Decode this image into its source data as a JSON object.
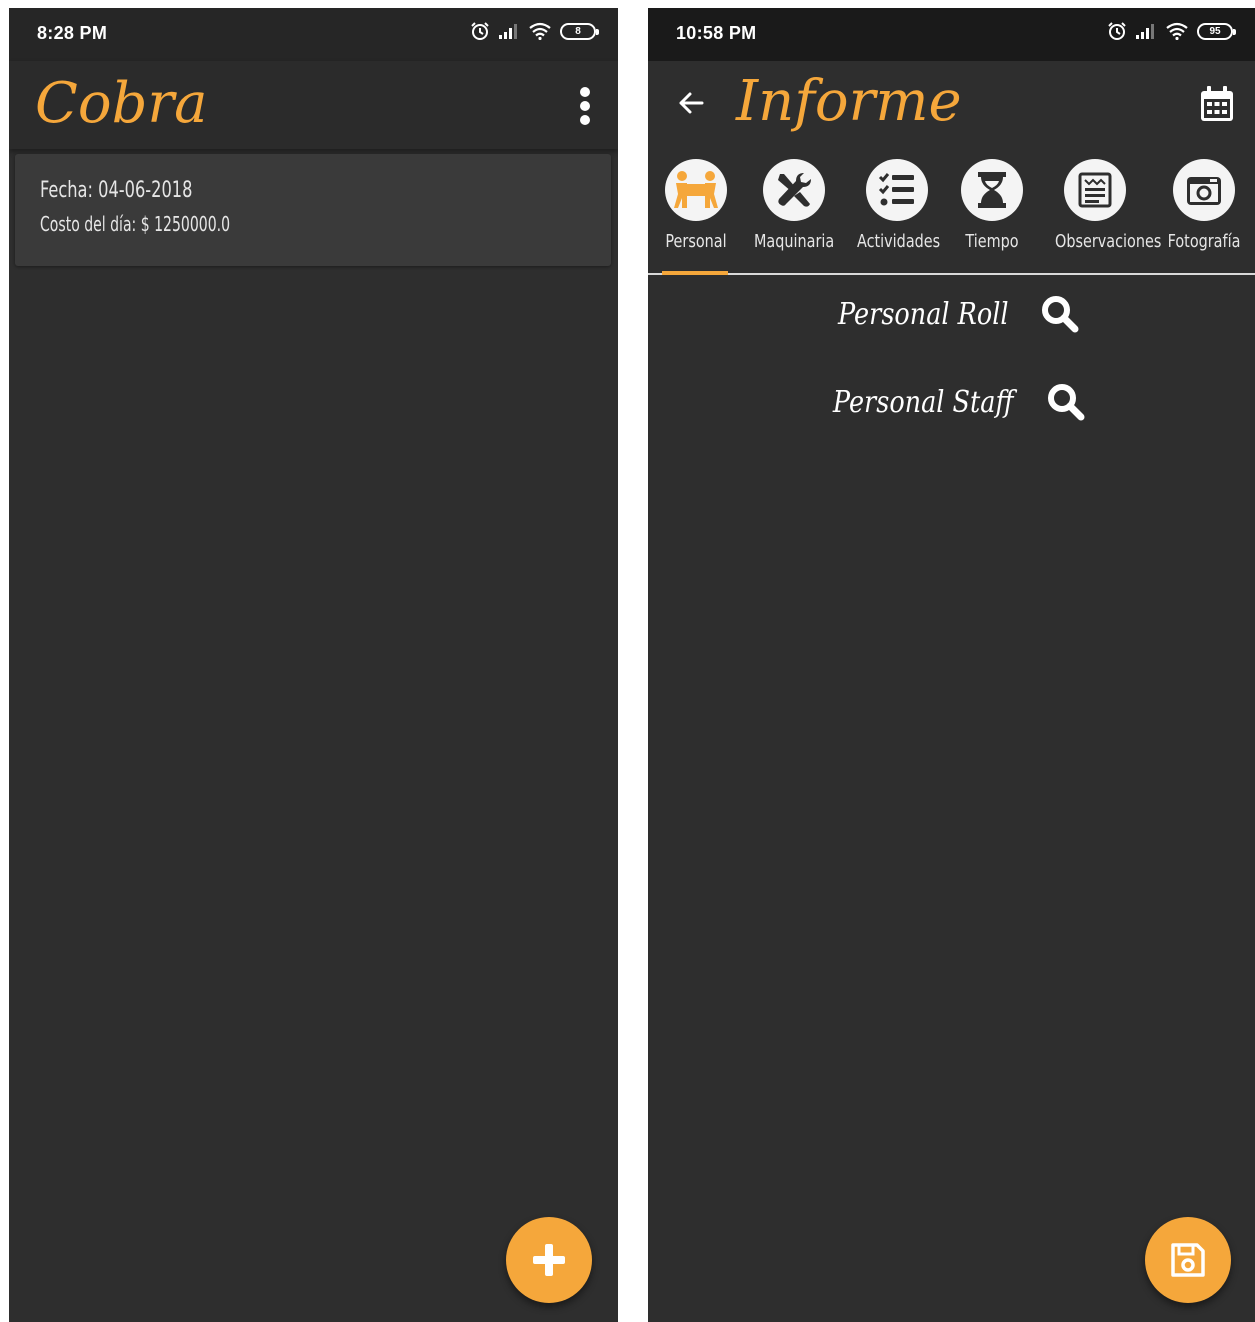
{
  "left_screen": {
    "status": {
      "time": "8:28 PM",
      "battery": "8"
    },
    "app_title": "Cobra",
    "card": {
      "fecha_label": "Fecha: 04-06-2018",
      "costo_label": "Costo del día: $ 1250000.0"
    },
    "fab_icon": "plus-icon"
  },
  "right_screen": {
    "status": {
      "time": "10:58 PM",
      "battery": "95"
    },
    "app_title": "Informe",
    "tabs": [
      {
        "label": "Personal",
        "icon": "people-carry-icon",
        "selected": true
      },
      {
        "label": "Maquinaria",
        "icon": "tools-icon",
        "selected": false
      },
      {
        "label": "Actividades",
        "icon": "tasks-icon",
        "selected": false
      },
      {
        "label": "Tiempo",
        "icon": "hourglass-icon",
        "selected": false
      },
      {
        "label": "Observaciones",
        "icon": "notes-icon",
        "selected": false
      },
      {
        "label": "Fotografía",
        "icon": "camera-icon",
        "selected": false
      }
    ],
    "search_items": [
      {
        "label": "Personal Roll"
      },
      {
        "label": "Personal Staff"
      }
    ],
    "fab_icon": "save-icon"
  },
  "colors": {
    "accent": "#f5a73b",
    "background": "#2e2e2e",
    "card": "#3a3a3a",
    "statusbar": "#262626"
  }
}
